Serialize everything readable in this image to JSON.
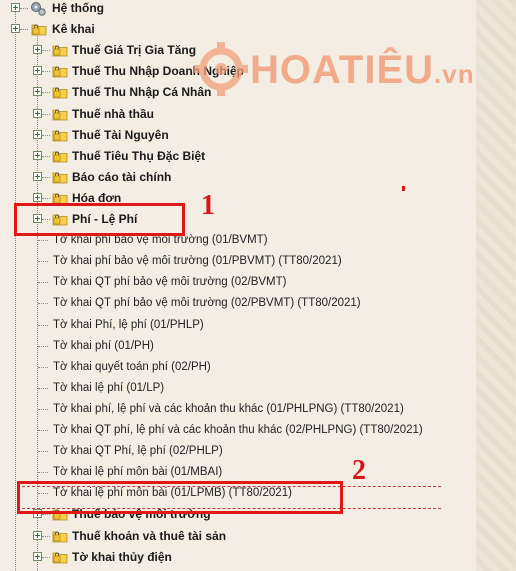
{
  "tree": {
    "root_items": [
      {
        "label": "Hệ thống"
      },
      {
        "label": "Kê khai"
      }
    ],
    "folders_top": [
      {
        "label": "Thuế Giá Trị Gia Tăng"
      },
      {
        "label": "Thuế Thu Nhập Doanh Nghiệp"
      },
      {
        "label": "Thuế Thu Nhập Cá Nhân"
      },
      {
        "label": "Thuế nhà thầu"
      },
      {
        "label": "Thuế Tài Nguyên"
      },
      {
        "label": "Thuế Tiêu Thụ Đặc Biệt"
      },
      {
        "label": "Báo cáo tài chính"
      },
      {
        "label": "Hóa đơn"
      },
      {
        "label": "Phí - Lệ Phí"
      }
    ],
    "leaves": [
      {
        "label": "Tờ khai phí bảo vệ môi trường (01/BVMT)"
      },
      {
        "label": "Tờ khai phí bảo vệ môi trường (01/PBVMT) (TT80/2021)"
      },
      {
        "label": "Tờ khai QT phí bảo vệ môi trường (02/BVMT)"
      },
      {
        "label": "Tờ khai QT phí bảo vệ môi trường (02/PBVMT) (TT80/2021)"
      },
      {
        "label": "Tờ khai Phí, lệ phí (01/PHLP)"
      },
      {
        "label": "Tờ khai phí (01/PH)"
      },
      {
        "label": "Tờ khai quyết toán phí (02/PH)"
      },
      {
        "label": "Tờ khai lệ phí (01/LP)"
      },
      {
        "label": "Tờ khai phí, lệ phí và các khoản thu khác (01/PHLPNG) (TT80/2021)"
      },
      {
        "label": "Tờ khai QT phí, lệ phí và các khoản thu khác (02/PHLPNG) (TT80/2021)"
      },
      {
        "label": "Tờ khai QT Phí, lệ phí (02/PHLP)"
      },
      {
        "label": "Tờ khai lệ phí môn bài (01/MBAI)"
      },
      {
        "label": "Tờ khai lệ phí môn bài (01/LPMB) (TT80/2021)"
      }
    ],
    "folders_bottom": [
      {
        "label": "Thuế bảo vệ môi trường"
      },
      {
        "label": "Thuế khoản và thuê tài sản"
      },
      {
        "label": "Tờ khai thủy điện"
      }
    ]
  },
  "annotations": {
    "marker_1": "1",
    "marker_2": "2",
    "highlight_color": "#e01818"
  },
  "watermark": {
    "main": "HOATIÊU",
    "suffix": ".vn"
  },
  "icons": {
    "root_1": "gear-icon",
    "folder": "folder-lock-icon",
    "expand": "expand-plus-icon"
  }
}
